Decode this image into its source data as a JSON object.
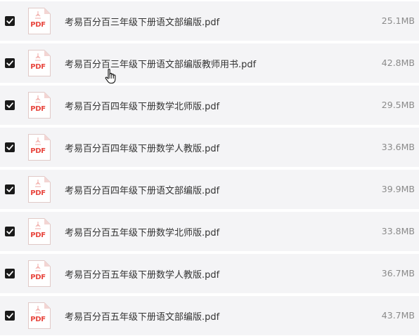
{
  "files": [
    {
      "name": "考易百分百三年级下册语文部编版.pdf",
      "size": "25.1MB",
      "type_label": "PDF",
      "checked": true
    },
    {
      "name": "考易百分百三年级下册语文部编版教师用书.pdf",
      "size": "42.8MB",
      "type_label": "PDF",
      "checked": true
    },
    {
      "name": "考易百分百四年级下册数学北师版.pdf",
      "size": "29.5MB",
      "type_label": "PDF",
      "checked": true
    },
    {
      "name": "考易百分百四年级下册数学人教版.pdf",
      "size": "33.6MB",
      "type_label": "PDF",
      "checked": true
    },
    {
      "name": "考易百分百四年级下册语文部编版.pdf",
      "size": "39.9MB",
      "type_label": "PDF",
      "checked": true
    },
    {
      "name": "考易百分百五年级下册数学北师版.pdf",
      "size": "33.8MB",
      "type_label": "PDF",
      "checked": true
    },
    {
      "name": "考易百分百五年级下册数学人教版.pdf",
      "size": "36.7MB",
      "type_label": "PDF",
      "checked": true
    },
    {
      "name": "考易百分百五年级下册语文部编版.pdf",
      "size": "43.7MB",
      "type_label": "PDF",
      "checked": true
    }
  ],
  "colors": {
    "row_background": "#f4f4f6",
    "pdf_accent": "#e8473f",
    "checkbox": "#1a1a1a"
  },
  "icons": {
    "checkbox": "checkbox-checked-icon",
    "file": "pdf-file-icon",
    "cursor": "hand-pointer-icon"
  }
}
